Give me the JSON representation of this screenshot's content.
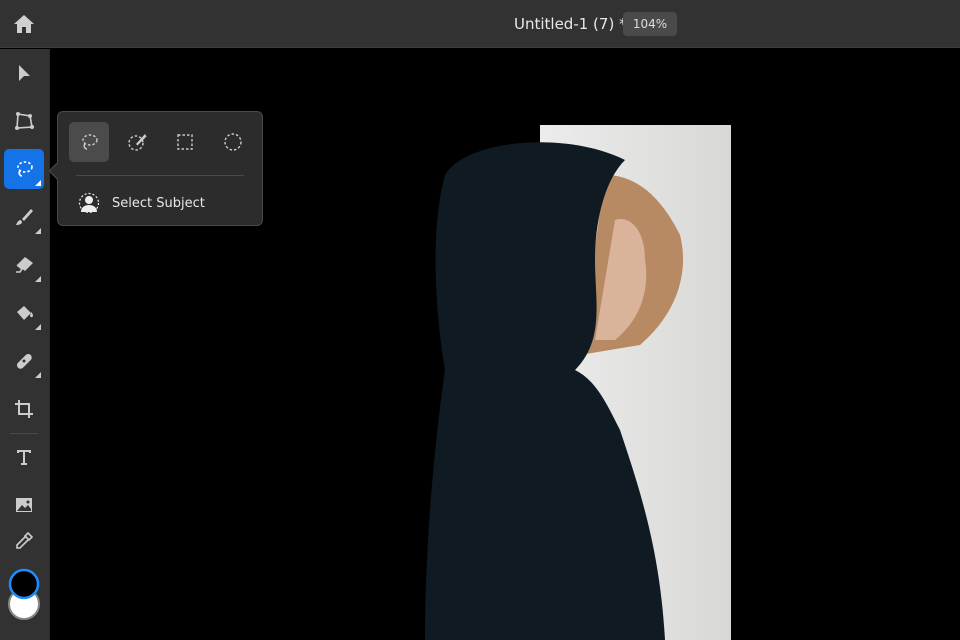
{
  "header": {
    "title": "Untitled-1 (7) *",
    "zoom": "104%"
  },
  "toolbar": {
    "tools": [
      "move",
      "transform",
      "lasso-select",
      "brush",
      "eraser",
      "fill",
      "healing",
      "crop",
      "type",
      "place-image",
      "eyedropper"
    ],
    "active": "lasso-select"
  },
  "selection_popup": {
    "tools": [
      "lasso",
      "quick-selection",
      "rectangular-marquee",
      "elliptical-marquee"
    ],
    "selected": "lasso",
    "select_subject_label": "Select Subject"
  },
  "colors": {
    "foreground": "#000000",
    "background": "#ffffff",
    "accent": "#1473e6"
  }
}
